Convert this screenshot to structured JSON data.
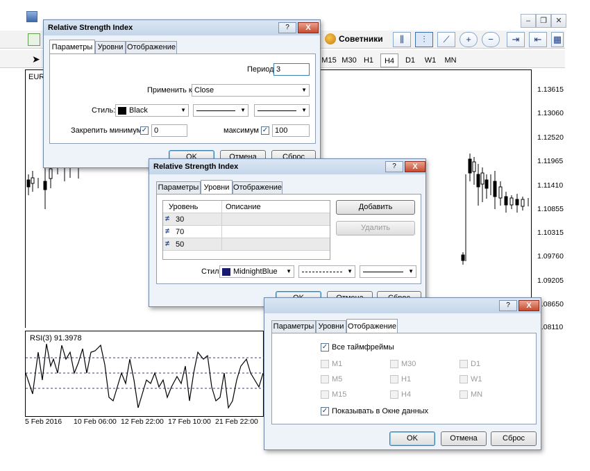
{
  "terminal": {
    "advisors_label": "Советники",
    "chart_symbol": "EUR",
    "timeframes": [
      "M15",
      "M30",
      "H1",
      "H4",
      "D1",
      "W1",
      "MN"
    ],
    "selected_timeframe": "H4",
    "price_axis": [
      "1.13615",
      "1.13060",
      "1.12520",
      "1.11965",
      "1.11410",
      "1.10855",
      "1.10315",
      "1.09760",
      "1.09205",
      "1.08650",
      "1.08110"
    ],
    "rsi_label": "RSI(3) 91.3978",
    "dates": [
      "5 Feb 2016",
      "10 Feb 06:00",
      "12 Feb 22:00",
      "17 Feb 10:00",
      "21 Feb 22:00"
    ]
  },
  "dialog_params": {
    "title": "Relative Strength Index",
    "help": "?",
    "close": "X",
    "tabs": [
      "Параметры",
      "Уровни",
      "Отображение"
    ],
    "period_label": "Период:",
    "period_value": "3",
    "apply_label": "Применить к:",
    "apply_value": "Close",
    "style_label": "Стиль:",
    "style_color": "Black",
    "fix_min_label": "Закрепить минимум",
    "fix_min_value": "0",
    "max_label": "максимум",
    "max_value": "100",
    "ok": "OK",
    "cancel": "Отмена",
    "reset": "Сброс"
  },
  "dialog_levels": {
    "title": "Relative Strength Index",
    "help": "?",
    "close": "X",
    "tabs": [
      "Параметры",
      "Уровни",
      "Отображение"
    ],
    "col_level": "Уровень",
    "col_desc": "Описание",
    "levels": [
      "30",
      "70",
      "50"
    ],
    "add": "Добавить",
    "remove": "Удалить",
    "style_label": "Стиль:",
    "style_color": "MidnightBlue",
    "ok": "OK",
    "cancel": "Отмена",
    "reset": "Сброс"
  },
  "dialog_display": {
    "help": "?",
    "close": "X",
    "tabs": [
      "Параметры",
      "Уровни",
      "Отображение"
    ],
    "all_tf": "Все таймфреймы",
    "tf": [
      "M1",
      "M30",
      "D1",
      "M5",
      "H1",
      "W1",
      "M15",
      "H4",
      "MN"
    ],
    "show_data": "Показывать в Окне данных",
    "ok": "OK",
    "cancel": "Отмена",
    "reset": "Сброс"
  }
}
